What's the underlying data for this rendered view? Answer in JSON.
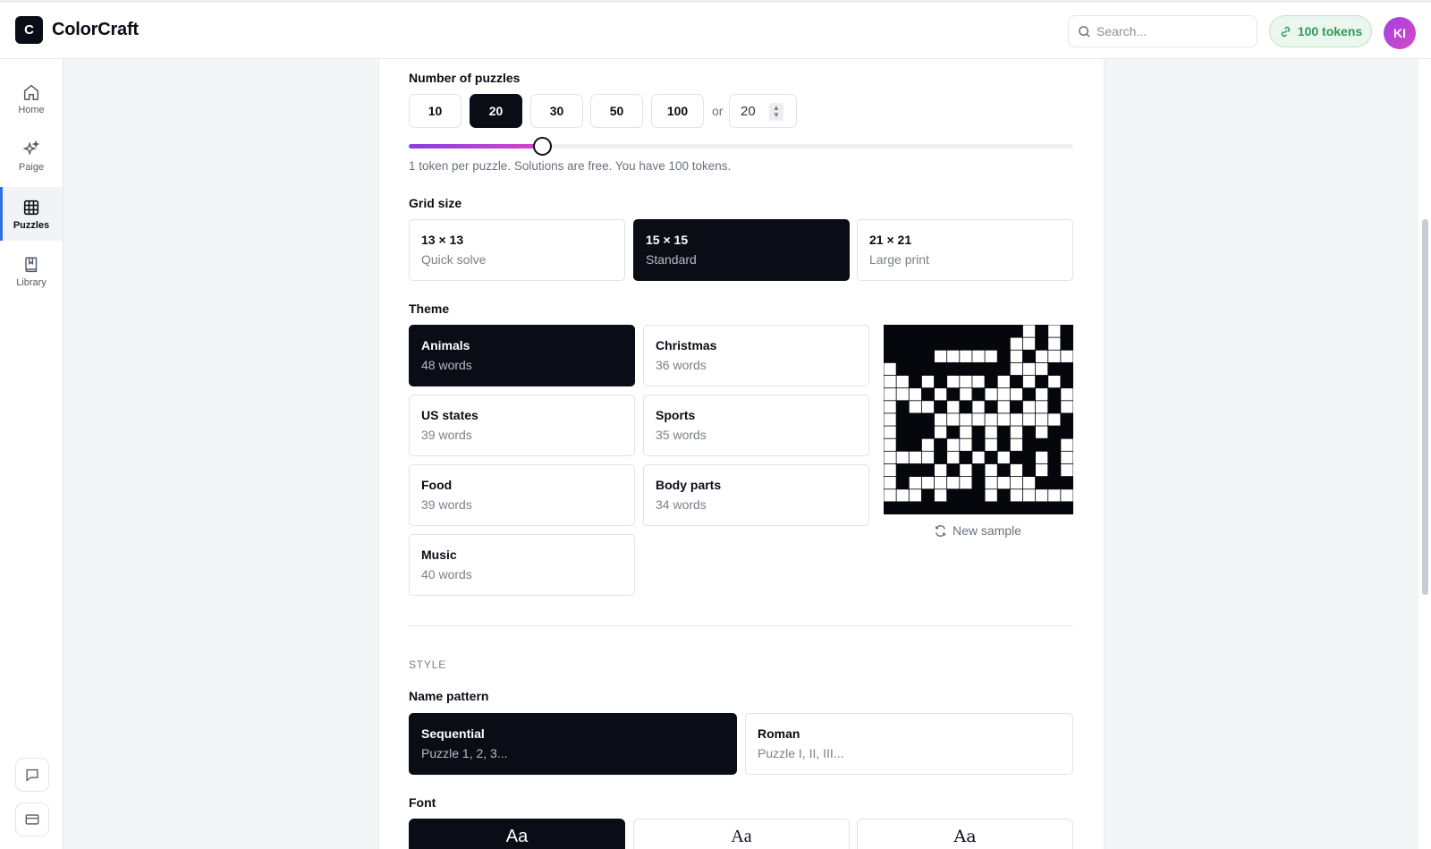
{
  "app": {
    "logo_letter": "C",
    "name": "ColorCraft"
  },
  "header": {
    "search_placeholder": "Search...",
    "tokens_label": "100 tokens",
    "avatar_initials": "KI"
  },
  "sidebar": {
    "items": [
      {
        "label": "Home",
        "icon": "home-icon"
      },
      {
        "label": "Paige",
        "icon": "sparkle-icon"
      },
      {
        "label": "Puzzles",
        "icon": "grid-icon",
        "active": true
      },
      {
        "label": "Library",
        "icon": "book-icon"
      }
    ],
    "bottom": [
      {
        "icon": "chat-icon"
      },
      {
        "icon": "card-icon"
      }
    ]
  },
  "count": {
    "label": "Number of puzzles",
    "options": [
      "10",
      "20",
      "30",
      "50",
      "100"
    ],
    "selected": "20",
    "or_text": "or",
    "custom_value": "20",
    "slider_fraction": 0.2,
    "hint": "1 token per puzzle. Solutions are free. You have 100 tokens."
  },
  "grid_size": {
    "label": "Grid size",
    "options": [
      {
        "title": "13 × 13",
        "subtitle": "Quick solve"
      },
      {
        "title": "15 × 15",
        "subtitle": "Standard",
        "selected": true
      },
      {
        "title": "21 × 21",
        "subtitle": "Large print"
      }
    ]
  },
  "theme": {
    "label": "Theme",
    "options": [
      {
        "title": "Animals",
        "subtitle": "48 words",
        "selected": true
      },
      {
        "title": "Christmas",
        "subtitle": "36 words"
      },
      {
        "title": "US states",
        "subtitle": "39 words"
      },
      {
        "title": "Sports",
        "subtitle": "35 words"
      },
      {
        "title": "Food",
        "subtitle": "39 words"
      },
      {
        "title": "Body parts",
        "subtitle": "34 words"
      },
      {
        "title": "Music",
        "subtitle": "40 words"
      }
    ],
    "new_sample_label": "New sample"
  },
  "style": {
    "caption": "STYLE",
    "name_pattern": {
      "label": "Name pattern",
      "options": [
        {
          "title": "Sequential",
          "subtitle": "Puzzle 1, 2, 3...",
          "selected": true
        },
        {
          "title": "Roman",
          "subtitle": "Puzzle I, II, III..."
        }
      ]
    },
    "font": {
      "label": "Font",
      "options": [
        "Aa",
        "Aa",
        "Aa"
      ]
    }
  },
  "colors": {
    "accent": "#0a0d16",
    "active_nav": "#2f6fe4",
    "token_green": "#2e9b58",
    "slider_start": "#8a3fe0",
    "slider_end": "#d447c8"
  }
}
